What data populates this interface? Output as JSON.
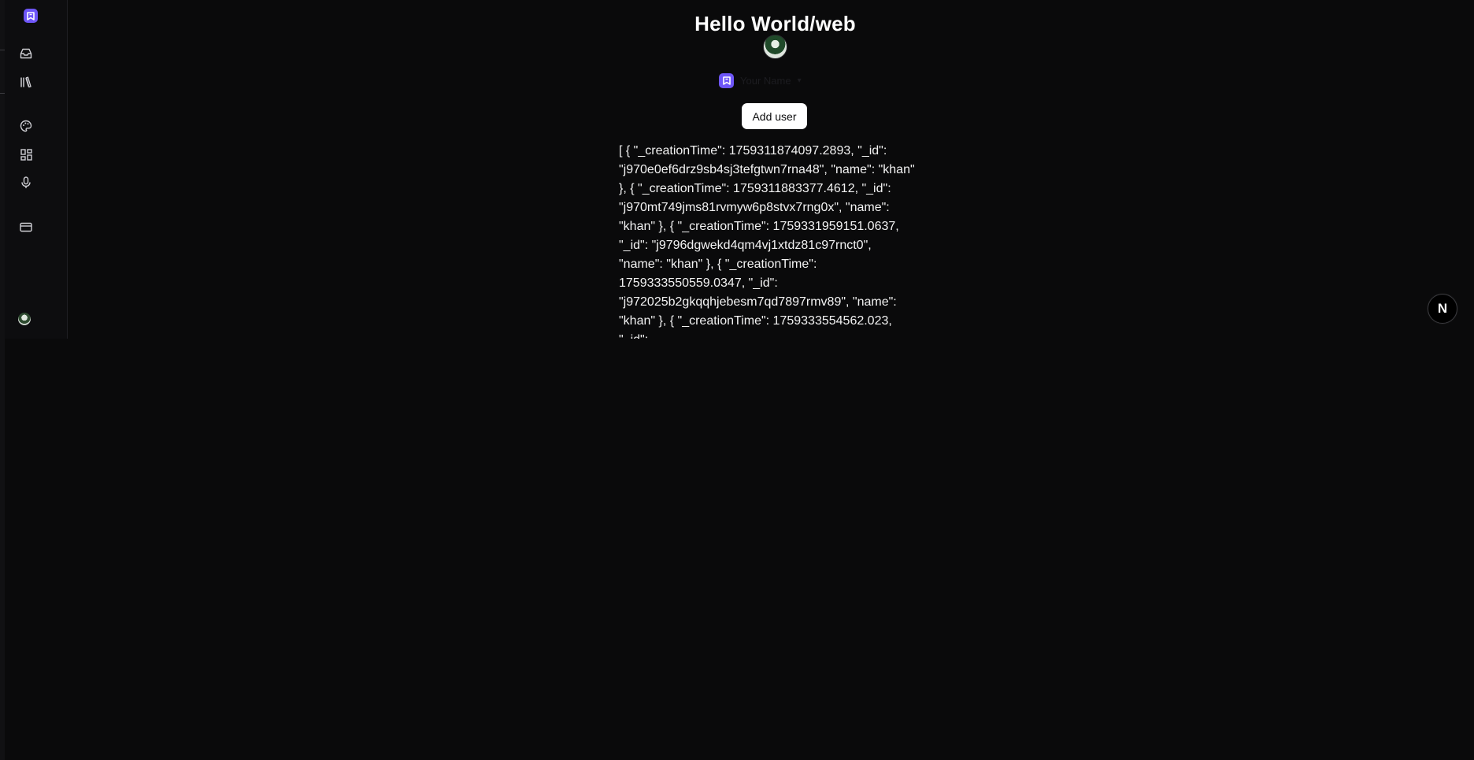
{
  "page": {
    "title": "Hello World/web"
  },
  "sidebar": {
    "items": [
      {
        "name": "inbox-icon"
      },
      {
        "name": "library-icon"
      },
      {
        "name": "palette-icon"
      },
      {
        "name": "dashboard-icon"
      },
      {
        "name": "microphone-icon"
      },
      {
        "name": "credit-card-icon"
      }
    ]
  },
  "org": {
    "name": "Your Name",
    "chevron": "▾"
  },
  "actions": {
    "add_user_label": "Add user"
  },
  "json_output": "[ { \"_creationTime\": 1759311874097.2893, \"_id\": \"j970e0ef6drz9sb4sj3tefgtwn7rna48\", \"name\": \"khan\" }, { \"_creationTime\": 1759311883377.4612, \"_id\": \"j970mt749jms81rvmyw6p8stvx7rng0x\", \"name\": \"khan\" }, { \"_creationTime\": 1759331959151.0637, \"_id\": \"j9796dgwekd4qm4vj1xtdz81c97rnct0\", \"name\": \"khan\" }, { \"_creationTime\": 1759333550559.0347, \"_id\": \"j972025b2gkqqhjebesm7qd7897rmv89\", \"name\": \"khan\" }, { \"_creationTime\": 1759333554562.023, \"_id\":",
  "nextjs_badge": {
    "letter": "N"
  },
  "colors": {
    "background": "#0a0a0b",
    "sidebar": "#0d0d0f",
    "accent": "#6e56f8",
    "button_bg": "#ffffff",
    "text": "#f3f3f3"
  }
}
